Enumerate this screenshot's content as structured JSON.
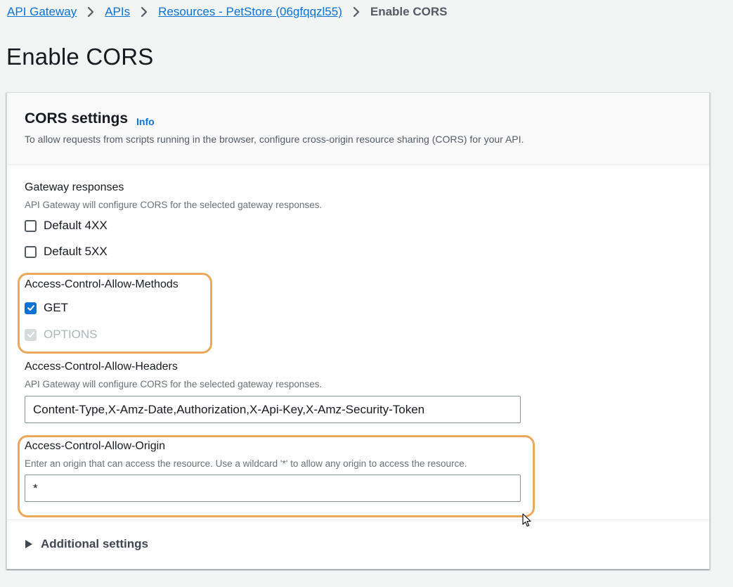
{
  "breadcrumb": {
    "items": [
      "API Gateway",
      "APIs",
      "Resources - PetStore (06gfqqzl55)"
    ],
    "current": "Enable CORS"
  },
  "page_title": "Enable CORS",
  "panel": {
    "title": "CORS settings",
    "info": "Info",
    "description": "To allow requests from scripts running in the browser, configure cross-origin resource sharing (CORS) for your API."
  },
  "gateway_responses": {
    "label": "Gateway responses",
    "description": "API Gateway will configure CORS for the selected gateway responses.",
    "options": [
      {
        "label": "Default 4XX",
        "checked": false
      },
      {
        "label": "Default 5XX",
        "checked": false
      }
    ]
  },
  "allow_methods": {
    "label": "Access-Control-Allow-Methods",
    "options": [
      {
        "label": "GET",
        "checked": true,
        "disabled": false
      },
      {
        "label": "OPTIONS",
        "checked": true,
        "disabled": true
      }
    ]
  },
  "allow_headers": {
    "label": "Access-Control-Allow-Headers",
    "description": "API Gateway will configure CORS for the selected gateway responses.",
    "value": "Content-Type,X-Amz-Date,Authorization,X-Api-Key,X-Amz-Security-Token"
  },
  "allow_origin": {
    "label": "Access-Control-Allow-Origin",
    "description": "Enter an origin that can access the resource. Use a wildcard '*' to allow any origin to access the resource.",
    "value": "*"
  },
  "additional_settings": {
    "label": "Additional settings",
    "expanded": false
  },
  "colors": {
    "link": "#0972d3",
    "highlight": "#eca85a",
    "checked": "#0972d3",
    "disabled": "#d5dbdb"
  },
  "icons": {
    "breadcrumb_separator": "chevron-right-icon",
    "checkbox_check": "checkmark-icon",
    "expander": "caret-right-icon",
    "cursor": "mouse-pointer-icon"
  }
}
